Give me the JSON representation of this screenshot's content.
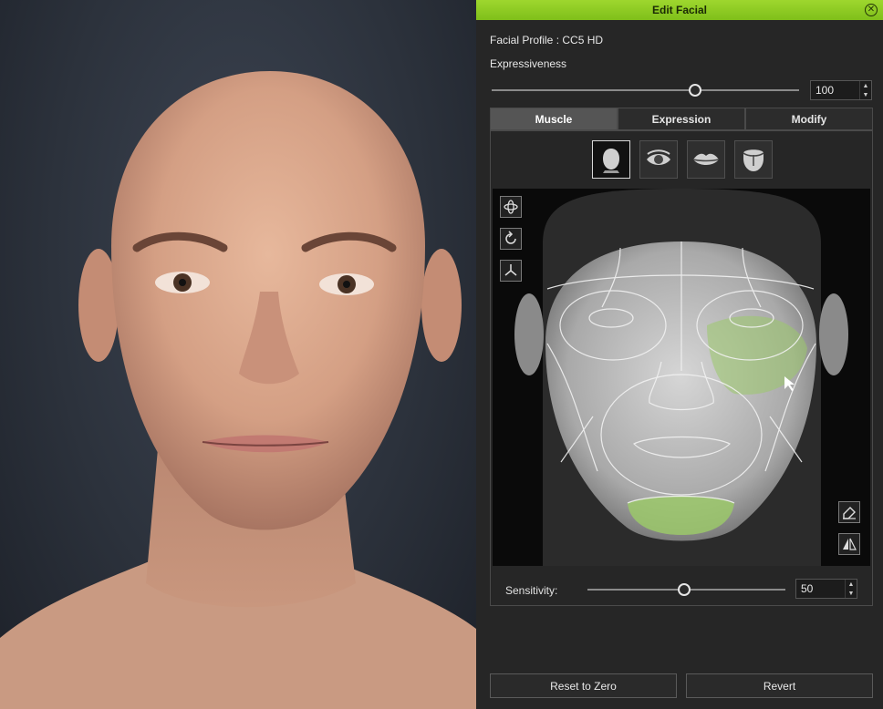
{
  "panel": {
    "title": "Edit Facial",
    "profile_line": "Facial Profile : CC5 HD",
    "expressiveness_label": "Expressiveness",
    "expressiveness_value": "100",
    "expressiveness_level": 1.0,
    "tabs": [
      {
        "label": "Muscle",
        "active": true
      },
      {
        "label": "Expression",
        "active": false
      },
      {
        "label": "Modify",
        "active": false
      }
    ],
    "categories": [
      "head-icon",
      "eye-icon",
      "lips-icon",
      "tongue-icon"
    ],
    "active_category": "head-icon",
    "map_tools": [
      "rotate-3d-icon",
      "reset-rotation-icon",
      "axis-icon"
    ],
    "map_side_tools": [
      "eraser-icon",
      "mirror-icon"
    ],
    "sensitivity_label": "Sensitivity:",
    "sensitivity_value": "50",
    "sensitivity_level": 0.5,
    "reset_button": "Reset to Zero",
    "revert_button": "Revert"
  },
  "colors": {
    "title_bar": "#8ccb22",
    "highlight_muscle": "#9bc86a",
    "panel_bg": "#262626"
  }
}
